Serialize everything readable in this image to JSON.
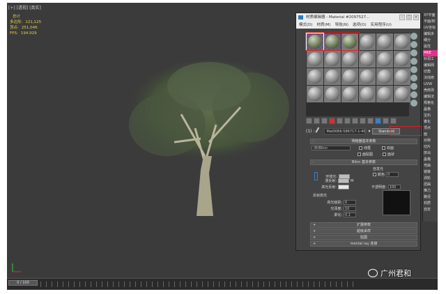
{
  "viewport": {
    "label": "[+] [透视] [真实]",
    "stats": [
      {
        "k": "",
        "v": "总计"
      },
      {
        "k": "多边形:",
        "v": "121,125"
      },
      {
        "k": "顶点:",
        "v": "251,046"
      },
      {
        "k": "",
        "v": ""
      },
      {
        "k": "FPS:",
        "v": "194.929"
      }
    ]
  },
  "material_editor": {
    "title": "材质编辑器 - Material #2097527...",
    "menu": [
      "模式(D)",
      "材质(M)",
      "导航(N)",
      "选项(O)",
      "实用程序(U)"
    ],
    "name_value": "Mat0066-586717-1-40...",
    "type_button": "Standard",
    "label_prefix": "(1) :",
    "rollouts": {
      "shader_basic": "明暗器基本参数",
      "blinn_basic": "Blinn 基本参数",
      "extended": "扩展参数",
      "supersampling": "超级采样",
      "maps": "贴图",
      "mentalray": "mental ray 连接"
    },
    "shader": {
      "select": "(B)Blinn",
      "wire": "线框",
      "two_sided": "双面",
      "face_map": "面贴图",
      "faceted": "面状"
    },
    "blinn": {
      "self_illum": "自发光",
      "color": "颜色",
      "color_val": "0",
      "ambient": "环境光:",
      "diffuse": "漫反射:",
      "specular": "高光反射:",
      "opacity": "不透明度:",
      "opacity_val": "100",
      "m_label": "M"
    },
    "highlights": {
      "title": "反射高光",
      "spec_level": "高光级别:",
      "spec_level_val": "0",
      "gloss": "光泽度:",
      "gloss_val": "10",
      "soften": "柔化:",
      "soften_val": "0.1"
    }
  },
  "command_panel": {
    "items": [
      "XY平面",
      "平面/积",
      "UV坐标",
      "编辑多",
      "细分",
      "属性",
      "MKE",
      "补洞工",
      "编辑网",
      "切角",
      "法线修",
      "UVW",
      "壳修改",
      "编辑法",
      "规格化",
      "晶格",
      "宝石",
      "锥化",
      "顶点",
      "面",
      "对称",
      "切片",
      "挤出",
      "晶格",
      "弯曲",
      "镜像",
      "涡轮",
      "扭曲",
      "推力",
      "路径",
      "材质",
      "自定"
    ],
    "highlight_index": 6
  },
  "timeline": {
    "frame": "0 / 100"
  },
  "watermark": {
    "text": "广州君和"
  }
}
